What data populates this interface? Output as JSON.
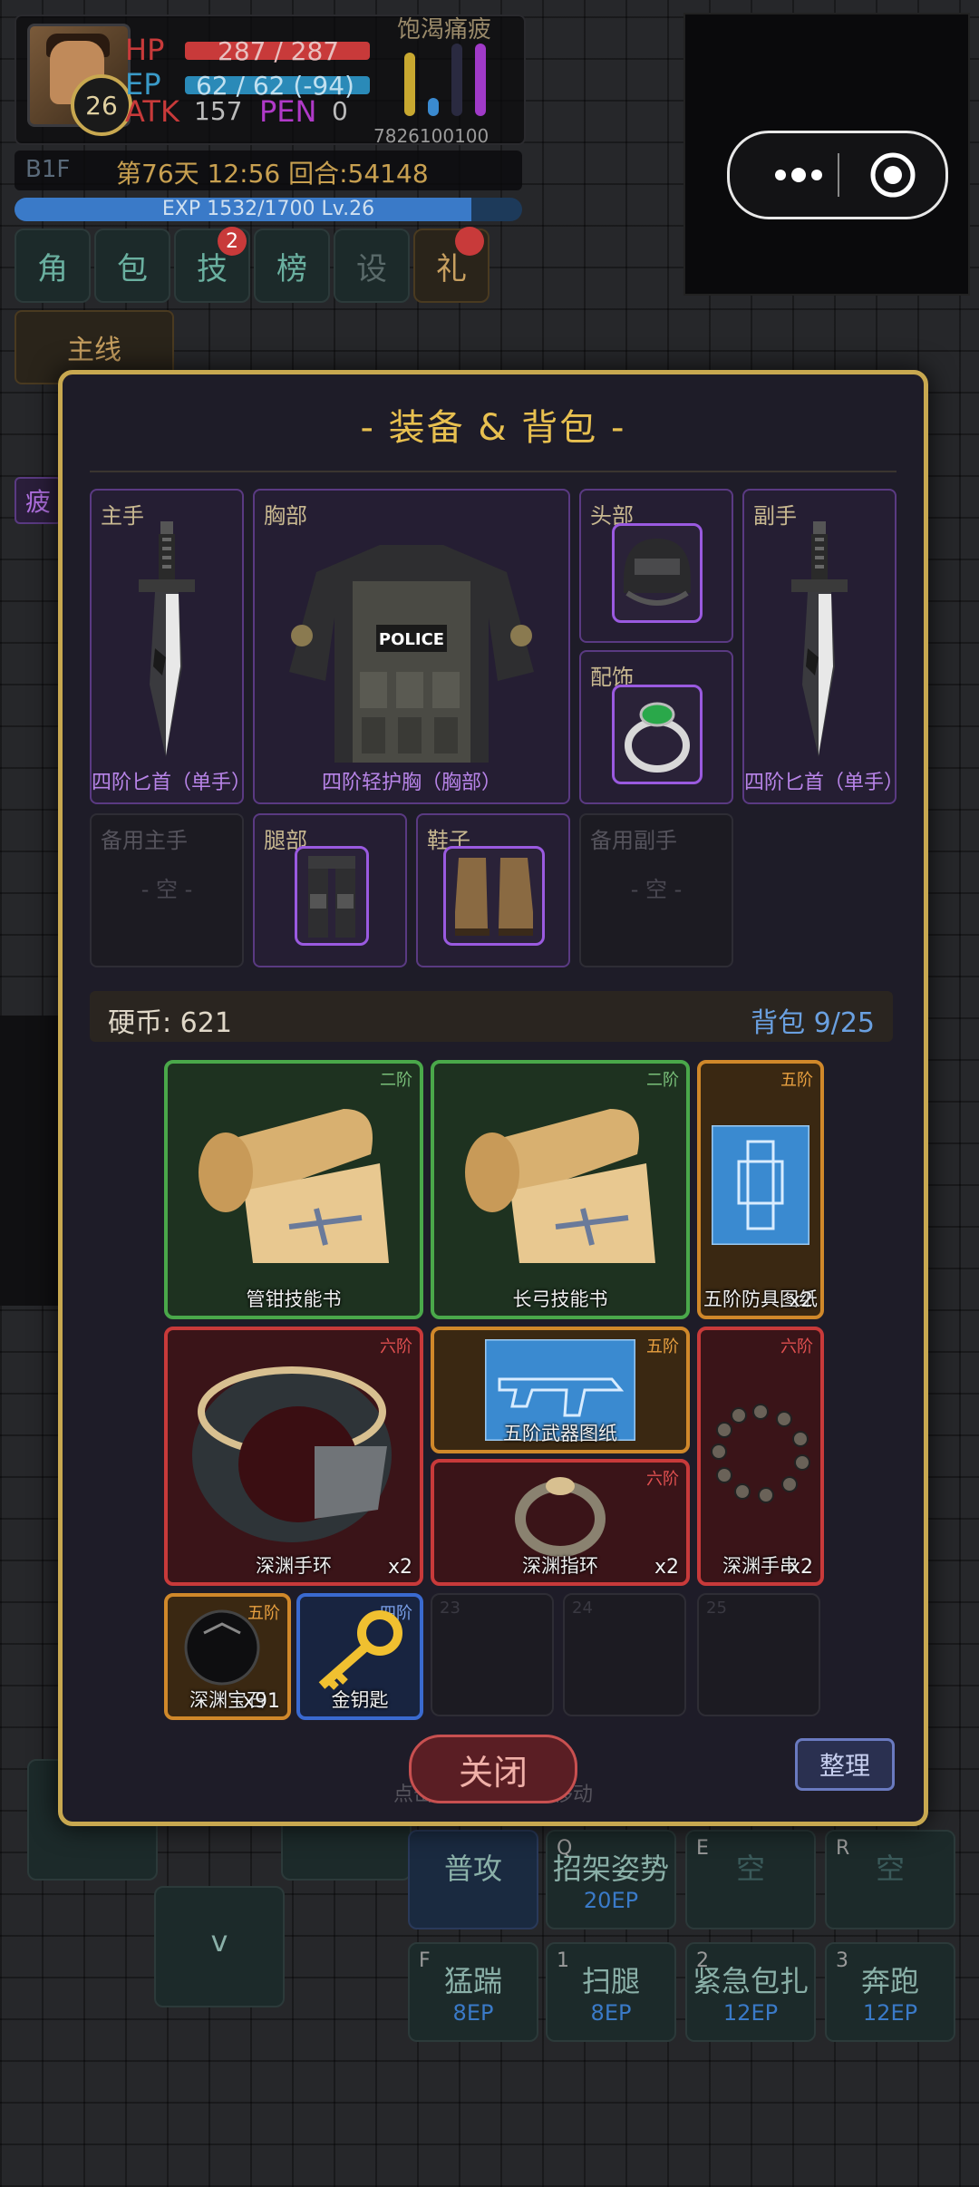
{
  "hud": {
    "level": "26",
    "hp_label": "HP",
    "hp_value": "287 / 287",
    "ep_label": "EP",
    "ep_value": "62 / 62 (-94)",
    "atk_label": "ATK",
    "atk_value": "157",
    "pen_label": "PEN",
    "pen_value": "0",
    "needs_label": "饱渴痛疲",
    "needs_numbers": "7826100100",
    "floor": "B1F",
    "day_time": "第76天 12:56 回合:54148",
    "exp_text": "EXP 1532/1700 Lv.26",
    "exp_fraction": 0.9
  },
  "menu": [
    {
      "label": "角"
    },
    {
      "label": "包"
    },
    {
      "label": "技",
      "badge": "2"
    },
    {
      "label": "榜"
    },
    {
      "label": "设"
    },
    {
      "label": "礼"
    }
  ],
  "quest_label": "主线",
  "status_effect": "疲",
  "controls": {
    "left": "<",
    "right": ">",
    "down": "v",
    "skills": [
      {
        "name": "普攻",
        "key": "",
        "cost": ""
      },
      {
        "name": "招架姿势",
        "key": "Q",
        "cost": "20EP"
      },
      {
        "name": "空",
        "key": "E",
        "cost": ""
      },
      {
        "name": "空",
        "key": "R",
        "cost": ""
      },
      {
        "name": "猛踹",
        "key": "F",
        "cost": "8EP"
      },
      {
        "name": "扫腿",
        "key": "1",
        "cost": "8EP"
      },
      {
        "name": "紧急包扎",
        "key": "2",
        "cost": "12EP"
      },
      {
        "name": "奔跑",
        "key": "3",
        "cost": "12EP"
      }
    ]
  },
  "modal": {
    "title": "- 装备 & 背包 -",
    "slots": {
      "main_hand": {
        "label": "主手",
        "item": "四阶匕首（单手）"
      },
      "chest": {
        "label": "胸部",
        "item": "四阶轻护胸（胸部）",
        "patch_text": "POLICE"
      },
      "head": {
        "label": "头部"
      },
      "off_hand": {
        "label": "副手",
        "item": "四阶匕首（单手）"
      },
      "accessory": {
        "label": "配饰"
      },
      "backup_main": {
        "label": "备用主手",
        "empty": "- 空 -"
      },
      "legs": {
        "label": "腿部"
      },
      "shoes": {
        "label": "鞋子"
      },
      "backup_off": {
        "label": "备用副手",
        "empty": "- 空 -"
      }
    },
    "coins": "硬币: 621",
    "bag": "背包 9/25",
    "items": [
      {
        "name": "管钳技能书",
        "tier": "二阶",
        "count": ""
      },
      {
        "name": "长弓技能书",
        "tier": "二阶",
        "count": ""
      },
      {
        "name": "五阶防具图纸",
        "tier": "五阶",
        "count": "x2"
      },
      {
        "name": "深渊手环",
        "tier": "六阶",
        "count": "x2"
      },
      {
        "name": "五阶武器图纸",
        "tier": "五阶",
        "count": ""
      },
      {
        "name": "深渊手串",
        "tier": "六阶",
        "count": "x2"
      },
      {
        "name": "深渊指环",
        "tier": "六阶",
        "count": "x2"
      },
      {
        "name": "深渊宝石",
        "tier": "五阶",
        "count": "x91"
      },
      {
        "name": "金钥匙",
        "tier": "四阶",
        "count": ""
      }
    ],
    "empty_slots": [
      "23",
      "24",
      "25"
    ],
    "close_label": "关闭",
    "sort_label": "整理",
    "hint": "点击装备后可拖拽移动"
  },
  "colors": {
    "gold_border": "#c8a850",
    "purple_slot": "#5a3a82",
    "tier2": "#4aa84a",
    "tier5": "#d0882a",
    "tier6": "#c83a3a",
    "tier4": "#3a6ad0"
  }
}
